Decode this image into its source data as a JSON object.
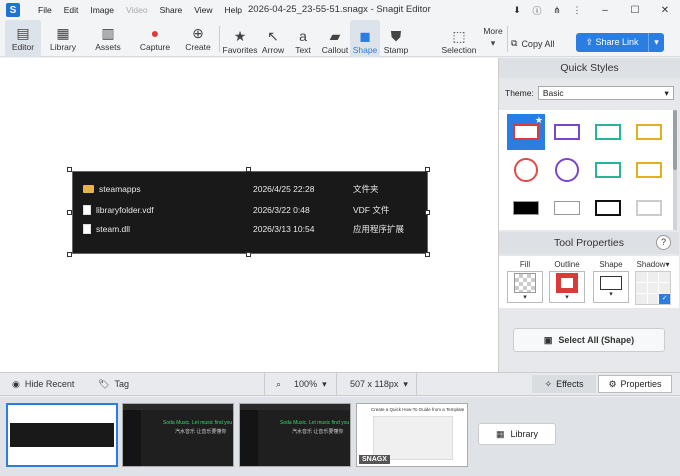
{
  "window": {
    "title": "2026-04-25_23-55-51.snagx - Snagit Editor",
    "logo_letter": "S",
    "menu": [
      "File",
      "Edit",
      "Image",
      "Video",
      "Share",
      "View",
      "Help"
    ],
    "menu_disabled": [
      "Video"
    ],
    "controls": {
      "minimize": "–",
      "maximize": "☐",
      "close": "✕"
    }
  },
  "toolbar": {
    "left": [
      {
        "label": "Editor",
        "icon": "editor-icon",
        "glyph": "▤",
        "selected": true
      },
      {
        "label": "Library",
        "icon": "library-icon",
        "glyph": "▦"
      },
      {
        "label": "Assets",
        "icon": "assets-icon",
        "glyph": "▥"
      },
      {
        "label": "Capture",
        "icon": "capture-icon",
        "glyph": "●"
      },
      {
        "label": "Create",
        "icon": "create-icon",
        "glyph": "⊕"
      }
    ],
    "tools": [
      {
        "label": "Favorites",
        "icon": "star-icon",
        "glyph": "★"
      },
      {
        "label": "Arrow",
        "icon": "arrow-icon",
        "glyph": "↖"
      },
      {
        "label": "Text",
        "icon": "text-icon",
        "glyph": "a"
      },
      {
        "label": "Callout",
        "icon": "callout-icon",
        "glyph": "💬"
      },
      {
        "label": "Shape",
        "icon": "shape-icon",
        "glyph": "◼",
        "selected": true
      },
      {
        "label": "Stamp",
        "icon": "stamp-icon",
        "glyph": "⛊"
      },
      {
        "label": "Selection",
        "icon": "selection-icon",
        "glyph": "⬚"
      },
      {
        "label": "More",
        "icon": "more-icon",
        "glyph": "▾"
      }
    ],
    "copy_all": "Copy All",
    "share_link": "Share Link"
  },
  "capture": {
    "files": [
      {
        "name": "steamapps",
        "date": "2026/4/25 22:28",
        "type": "文件夹",
        "icon": "folder"
      },
      {
        "name": "libraryfolder.vdf",
        "date": "2026/3/22 0:48",
        "type": "VDF 文件",
        "icon": "file"
      },
      {
        "name": "steam.dll",
        "date": "2026/3/13 10:54",
        "type": "应用程序扩展",
        "icon": "file"
      }
    ]
  },
  "quick_styles": {
    "title": "Quick Styles",
    "theme_label": "Theme:",
    "theme_value": "Basic",
    "swatches": [
      {
        "shape": "rect",
        "color": "#d93b3b",
        "selected": true
      },
      {
        "shape": "rect",
        "color": "#7b46c8"
      },
      {
        "shape": "rect",
        "color": "#2bb39a"
      },
      {
        "shape": "rect",
        "color": "#e2b020"
      },
      {
        "shape": "circle",
        "color": "#e04a4a"
      },
      {
        "shape": "circle",
        "color": "#7b46c8"
      },
      {
        "shape": "rect",
        "color": "#2bb39a"
      },
      {
        "shape": "rect",
        "color": "#e2b020"
      },
      {
        "shape": "fill",
        "color": "#000000"
      },
      {
        "shape": "fill",
        "color": "#ffffff"
      },
      {
        "shape": "rect",
        "color": "#111111"
      },
      {
        "shape": "rect",
        "color": "#cccccc"
      }
    ]
  },
  "tool_properties": {
    "title": "Tool Properties",
    "help": "?",
    "fill_label": "Fill",
    "outline_label": "Outline",
    "shape_label": "Shape",
    "shadow_label": "Shadow",
    "outline_color": "#d93b3b"
  },
  "select_all": "Select All (Shape)",
  "status": {
    "hide_recent": "Hide Recent",
    "tag": "Tag",
    "zoom": "100%",
    "dimensions": "507 x 118px",
    "effects": "Effects",
    "properties": "Properties"
  },
  "tray": {
    "library_label": "Library",
    "snagx_badge": "SNAGX",
    "thumb2_caption": "Soda Music. Let music find you",
    "thumb2_sub": "汽水音乐 让音乐要懂你",
    "thumb4_caption": "Create a Quick How-To Guide from a Template"
  }
}
